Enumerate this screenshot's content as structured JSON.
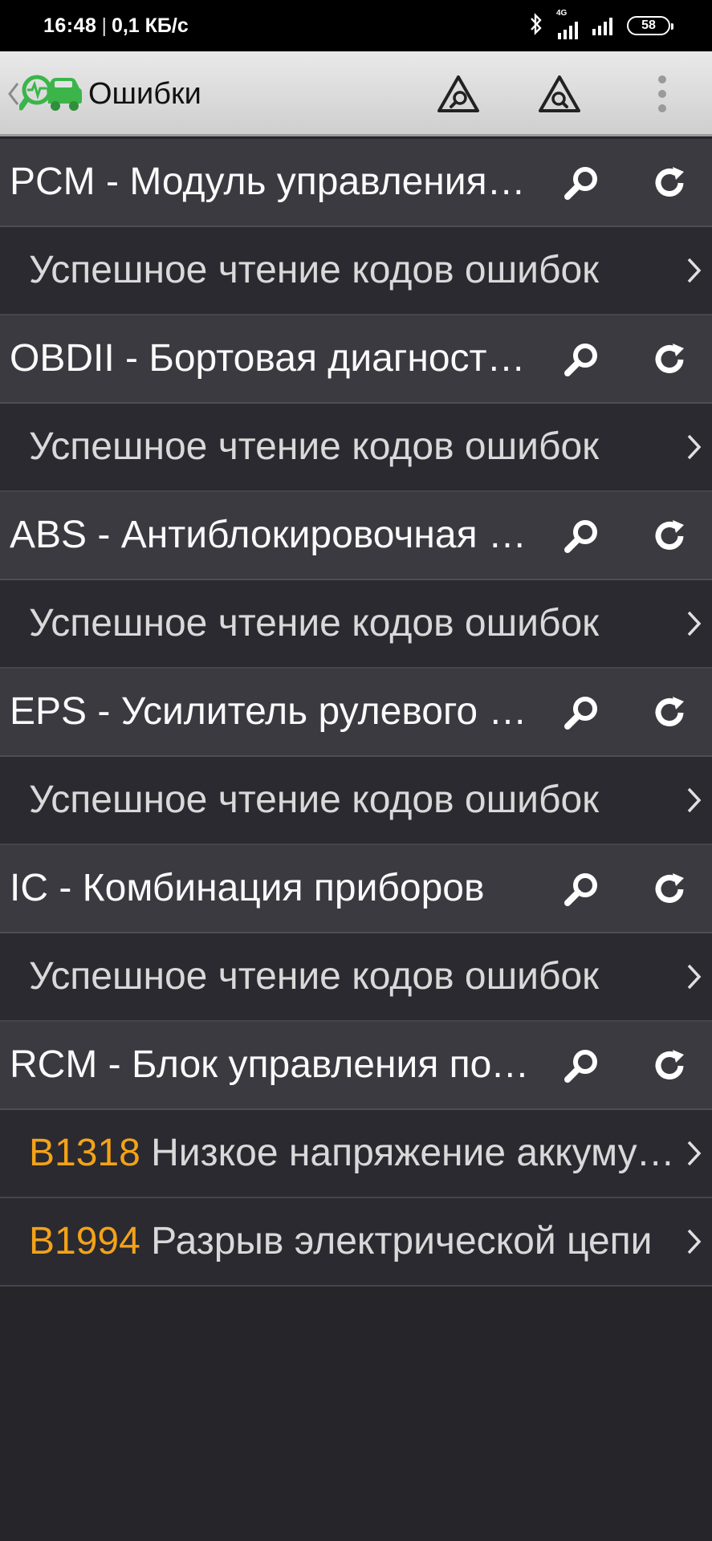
{
  "status_bar": {
    "time": "16:48",
    "separator": "|",
    "speed": "0,1 КБ/с",
    "network": "4G",
    "battery": "58"
  },
  "app_bar": {
    "title": "Ошибки",
    "back_icon": "chevron-left-icon",
    "logo_icon": "car-diagnostic-logo-icon",
    "actions": [
      "scan-warning-icon",
      "scan-warning-icon",
      "more-vert-icon"
    ]
  },
  "colors": {
    "code": "#f3a21a",
    "module_row_bg": "#3a3a40",
    "result_row_bg": "#2a2a30",
    "logo_green": "#3bb54a"
  },
  "modules": [
    {
      "title": "PCM - Модуль управления двигателем",
      "result_code": "",
      "result": "Успешное чтение кодов ошибок"
    },
    {
      "title": "OBDII - Бортовая диагностика",
      "result_code": "",
      "result": "Успешное чтение кодов ошибок"
    },
    {
      "title": "ABS - Антиблокировочная система",
      "result_code": "",
      "result": "Успешное чтение кодов ошибок"
    },
    {
      "title": "EPS - Усилитель рулевого управления",
      "result_code": "",
      "result": "Успешное чтение кодов ошибок"
    },
    {
      "title": "IC - Комбинация приборов",
      "result_code": "",
      "result": "Успешное чтение кодов ошибок"
    },
    {
      "title": "RCM - Блок управления подушками безопасности",
      "result_code": "",
      "result": ""
    }
  ],
  "dtc_rows": [
    {
      "code": "B1318",
      "text": "Низкое напряжение аккумулятора"
    },
    {
      "code": "B1994",
      "text": "Разрыв электрической цепи"
    }
  ]
}
